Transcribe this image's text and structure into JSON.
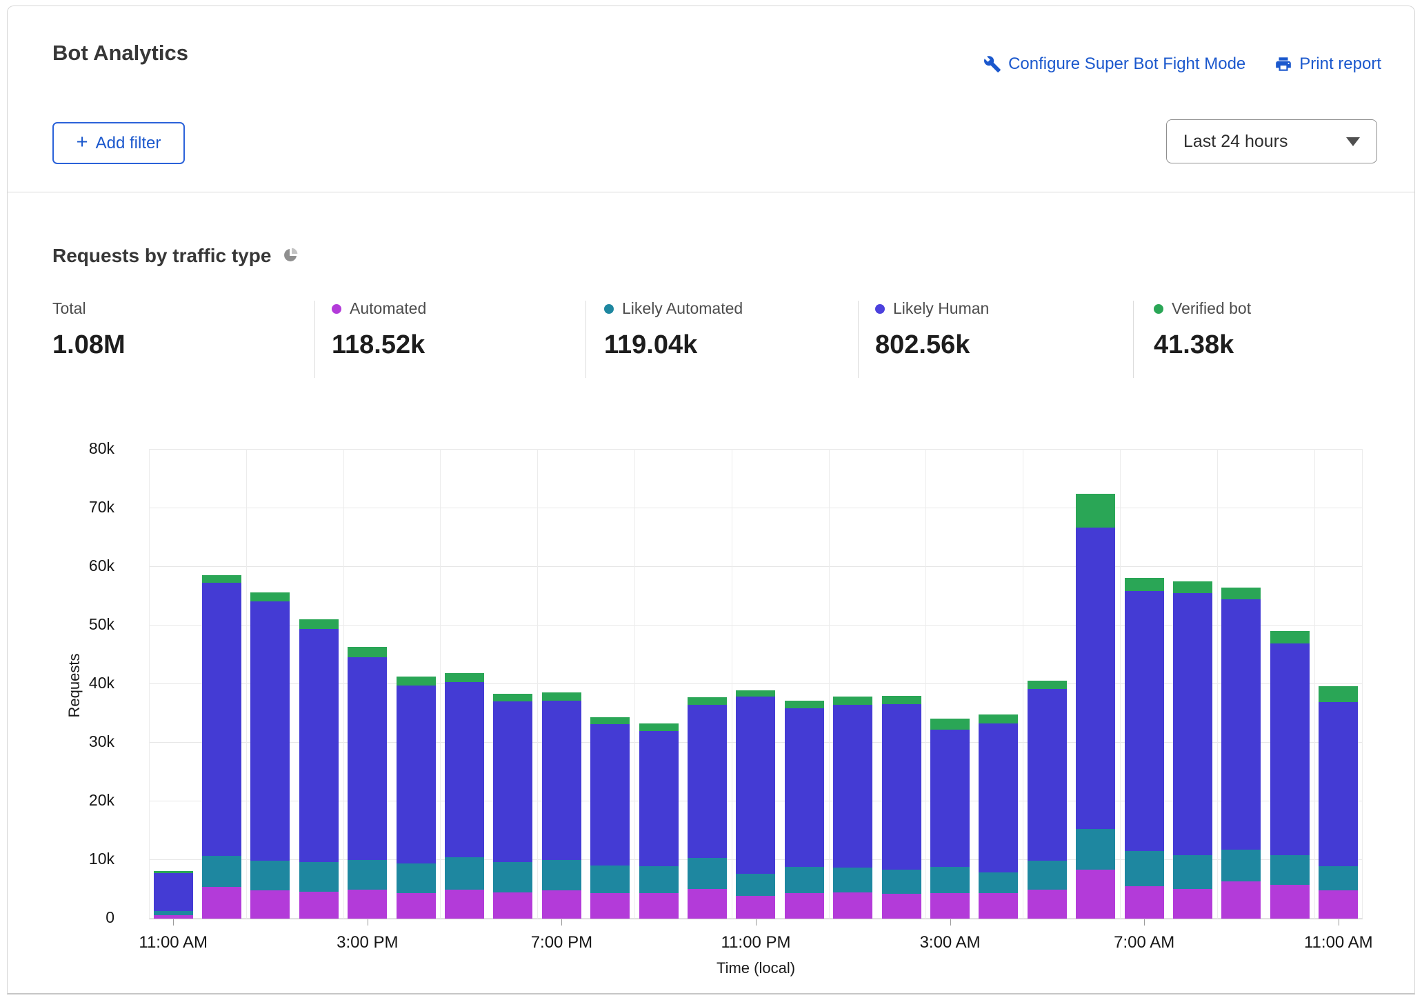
{
  "header": {
    "title": "Bot Analytics",
    "configure_link": "Configure Super Bot Fight Mode",
    "print_link": "Print report",
    "add_filter_label": "Add filter",
    "time_range_value": "Last 24 hours"
  },
  "section": {
    "title": "Requests by traffic type"
  },
  "stats": [
    {
      "label": "Total",
      "value": "1.08M",
      "color": null
    },
    {
      "label": "Automated",
      "value": "118.52k",
      "color": "#b33bd9"
    },
    {
      "label": "Likely Automated",
      "value": "119.04k",
      "color": "#1e87a0"
    },
    {
      "label": "Likely Human",
      "value": "802.56k",
      "color": "#4c41dd"
    },
    {
      "label": "Verified bot",
      "value": "41.38k",
      "color": "#2aa656"
    }
  ],
  "colors": {
    "link_blue": "#1b58cd",
    "automated": "#b33bd9",
    "likely_automated": "#1e87a0",
    "likely_human": "#443bd4",
    "verified_bot": "#2aa656",
    "gridline": "#e7e7e7"
  },
  "chart_data": {
    "type": "bar",
    "subtype": "stacked",
    "title": "Requests by traffic type",
    "xlabel": "Time (local)",
    "ylabel": "Requests",
    "ylim": [
      0,
      80000
    ],
    "grid": true,
    "legend_position": "top-stats-row",
    "value_units": "thousands of requests",
    "y_ticks": [
      "0",
      "10k",
      "20k",
      "30k",
      "40k",
      "50k",
      "60k",
      "70k",
      "80k"
    ],
    "x": [
      "11:00 AM",
      "12:00 PM",
      "1:00 PM",
      "2:00 PM",
      "3:00 PM",
      "4:00 PM",
      "5:00 PM",
      "6:00 PM",
      "7:00 PM",
      "8:00 PM",
      "9:00 PM",
      "10:00 PM",
      "11:00 PM",
      "12:00 AM",
      "1:00 AM",
      "2:00 AM",
      "3:00 AM",
      "4:00 AM",
      "5:00 AM",
      "6:00 AM",
      "7:00 AM",
      "8:00 AM",
      "9:00 AM",
      "10:00 AM",
      "11:00 AM"
    ],
    "x_tick_indices": [
      0,
      4,
      8,
      12,
      16,
      20,
      24
    ],
    "x_tick_labels": [
      "11:00 AM",
      "3:00 PM",
      "7:00 PM",
      "11:00 PM",
      "3:00 AM",
      "7:00 AM",
      "11:00 AM"
    ],
    "series": [
      {
        "name": "Automated",
        "color": "#b33bd9",
        "values": [
          0.6,
          5.4,
          4.8,
          4.6,
          5.0,
          4.4,
          4.9,
          4.5,
          4.8,
          4.4,
          4.3,
          5.1,
          3.9,
          4.4,
          4.5,
          4.2,
          4.3,
          4.3,
          4.9,
          8.4,
          5.5,
          5.1,
          6.3,
          5.8,
          4.8
        ]
      },
      {
        "name": "Likely Automated",
        "color": "#1e87a0",
        "values": [
          0.7,
          5.3,
          5.1,
          5.1,
          5.0,
          5.0,
          5.6,
          5.2,
          5.2,
          4.7,
          4.7,
          5.3,
          3.8,
          4.4,
          4.2,
          4.2,
          4.5,
          3.6,
          5.0,
          6.9,
          6.0,
          5.7,
          5.5,
          5.0,
          4.2
        ]
      },
      {
        "name": "Likely Human",
        "color": "#443bd4",
        "values": [
          6.5,
          46.6,
          44.2,
          39.7,
          34.6,
          30.4,
          29.8,
          27.4,
          27.2,
          24.1,
          23.0,
          26.1,
          30.2,
          27.1,
          27.8,
          28.2,
          23.4,
          25.4,
          29.3,
          51.4,
          44.4,
          44.7,
          42.7,
          36.1,
          28.0
        ]
      },
      {
        "name": "Verified bot",
        "color": "#2aa656",
        "values": [
          0.3,
          1.3,
          1.6,
          1.7,
          1.8,
          1.5,
          1.6,
          1.3,
          1.4,
          1.1,
          1.3,
          1.3,
          1.0,
          1.3,
          1.4,
          1.4,
          1.9,
          1.5,
          1.4,
          5.8,
          2.2,
          2.0,
          2.0,
          2.2,
          2.6
        ]
      }
    ],
    "totals": {
      "total": "1.08M",
      "automated": "118.52k",
      "likely_automated": "119.04k",
      "likely_human": "802.56k",
      "verified_bot": "41.38k"
    }
  }
}
